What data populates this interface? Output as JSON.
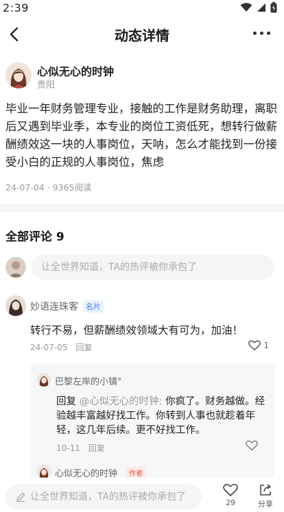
{
  "status": {
    "time": "2:39"
  },
  "nav": {
    "title": "动态详情"
  },
  "author": {
    "name": "心似无心的时钟",
    "location": "贵阳"
  },
  "post": {
    "text": "毕业一年财务管理专业，接触的工作是财务助理，离职后又遇到毕业季，本专业的岗位工资低死，想转行做薪酬绩效这一块的人事岗位，天呐，怎么才能找到一份接受小白的正规的人事岗位，焦虑",
    "meta": "24-07-04 · 9365阅读"
  },
  "comments_section": {
    "title": "全部评论 9",
    "input_placeholder": "让全世界知道，TA的热评被你承包了"
  },
  "comment": {
    "name": "妙语连珠客",
    "tag": "名片",
    "text": "转行不易，但薪酬绩效领域大有可为，加油！",
    "date": "24-07-05",
    "reply_label": "回复",
    "likes": "1",
    "replies": [
      {
        "name": "巴黎左岸的小镇°",
        "prefix": "回复 ",
        "at": "@心似无心的时钟:",
        "text": " 你疯了。财务越做。经验越丰富越好找工作。你转到人事也就趁着年轻，这几年后续。更不好找工作。",
        "date": "10-11",
        "reply_label": "回复"
      },
      {
        "name": "心似无心的时钟",
        "tag": "作者"
      }
    ]
  },
  "bottom": {
    "placeholder": "让全世界知道，TA的热评被你承包了",
    "like_count": "29",
    "share_label": "分享"
  }
}
